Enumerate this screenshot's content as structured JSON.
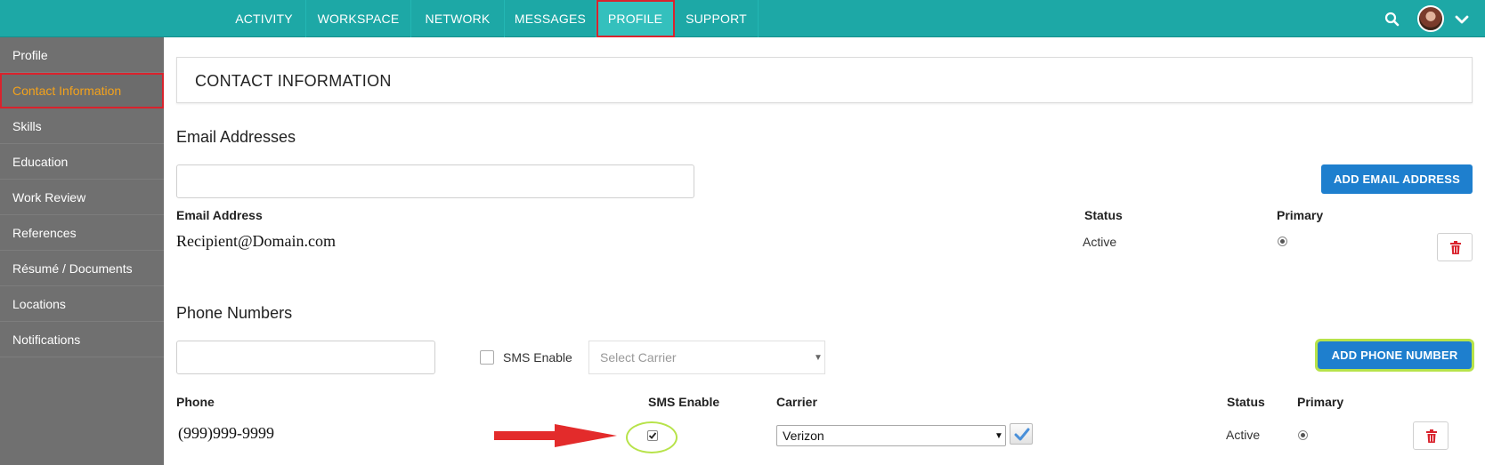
{
  "nav": {
    "items": [
      {
        "label": "ACTIVITY"
      },
      {
        "label": "WORKSPACE"
      },
      {
        "label": "NETWORK"
      },
      {
        "label": "MESSAGES"
      },
      {
        "label": "PROFILE"
      },
      {
        "label": "SUPPORT"
      }
    ],
    "active": "PROFILE",
    "search_icon": "search-icon",
    "menu_icon": "chevron-down-icon"
  },
  "sidebar": {
    "items": [
      {
        "label": "Profile"
      },
      {
        "label": "Contact Information"
      },
      {
        "label": "Skills"
      },
      {
        "label": "Education"
      },
      {
        "label": "Work Review"
      },
      {
        "label": "References"
      },
      {
        "label": "Résumé / Documents"
      },
      {
        "label": "Locations"
      },
      {
        "label": "Notifications"
      }
    ],
    "active": "Contact Information"
  },
  "main": {
    "title": "CONTACT INFORMATION",
    "email": {
      "section_title": "Email Addresses",
      "input_value": "",
      "add_button": "ADD EMAIL ADDRESS",
      "columns": {
        "address": "Email Address",
        "status": "Status",
        "primary": "Primary"
      },
      "rows": [
        {
          "address": "Recipient@Domain.com",
          "status": "Active",
          "primary": true
        }
      ]
    },
    "phone": {
      "section_title": "Phone Numbers",
      "input_value": "",
      "sms_label": "SMS Enable",
      "sms_checked": false,
      "carrier_placeholder": "Select Carrier",
      "add_button": "ADD PHONE NUMBER",
      "columns": {
        "phone": "Phone",
        "sms": "SMS Enable",
        "carrier": "Carrier",
        "status": "Status",
        "primary": "Primary"
      },
      "rows": [
        {
          "phone": "(999)999-9999",
          "sms_enabled": true,
          "carrier": "Verizon",
          "status": "Active",
          "primary": true
        }
      ]
    }
  },
  "colors": {
    "nav_bg": "#1da8a6",
    "sidebar_bg": "#707070",
    "sidebar_active_text": "#f3a21c",
    "button_primary": "#1e7fce",
    "highlight_red": "#d9232d",
    "highlight_green": "#b7e34a",
    "delete_icon": "#d9232d"
  }
}
